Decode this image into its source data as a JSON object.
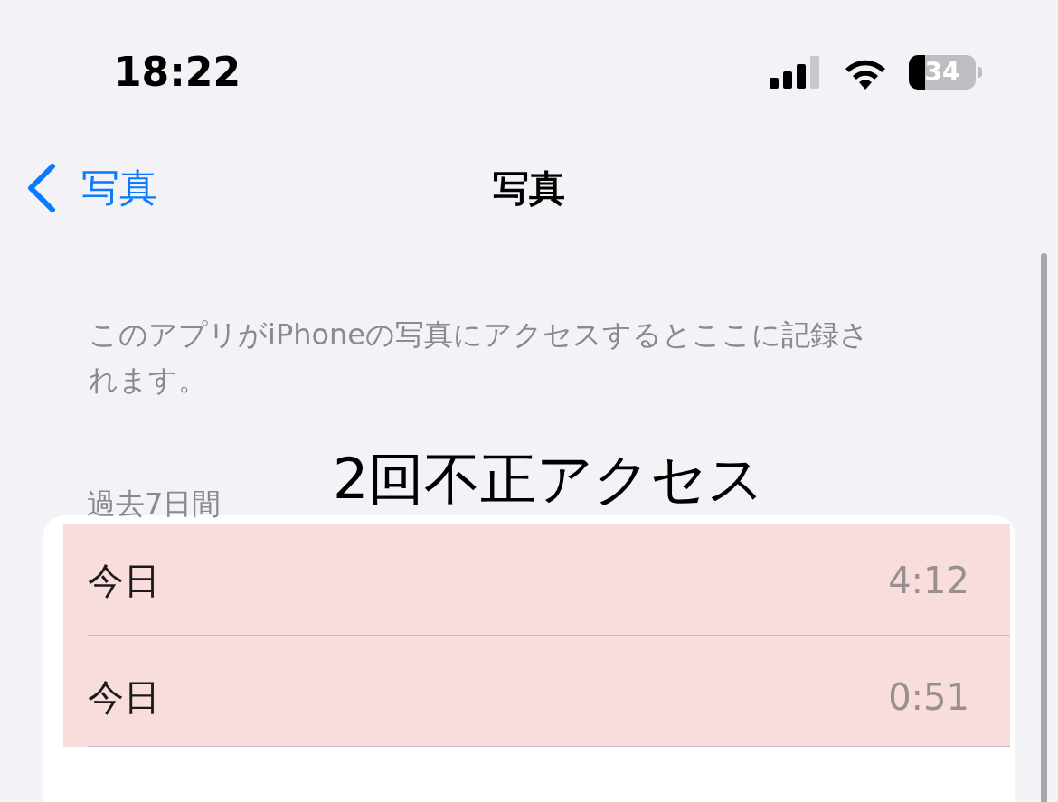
{
  "status_bar": {
    "time": "18:22",
    "battery": "34"
  },
  "nav": {
    "back_label": "写真",
    "title": "写真"
  },
  "description": "このアプリがiPhoneの写真にアクセスするとここに記録されます。",
  "annotation": "2回不正アクセス",
  "section": {
    "header": "過去7日間",
    "rows": [
      {
        "label": "今日",
        "time": "4:12",
        "highlighted": true
      },
      {
        "label": "今日",
        "time": "0:51",
        "highlighted": true
      }
    ]
  }
}
